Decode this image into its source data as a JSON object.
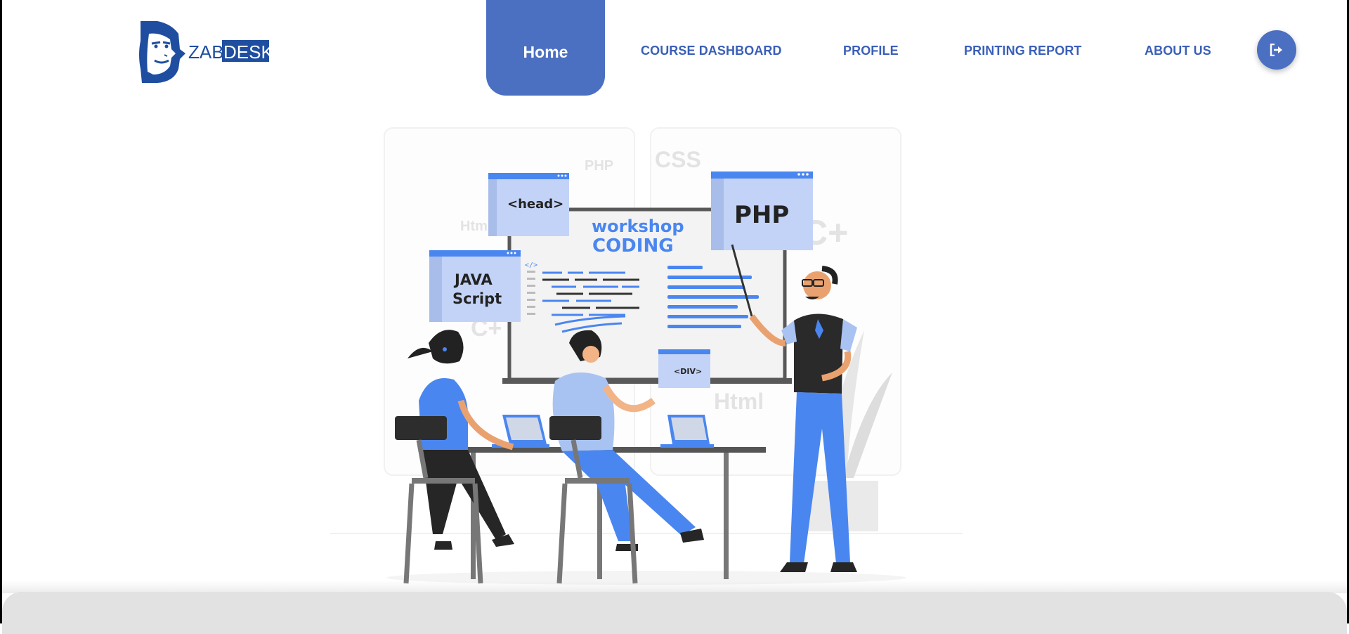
{
  "header": {
    "logo_text_left": "ZAB",
    "logo_text_right": "DESK"
  },
  "nav": {
    "home": "Home",
    "course_dashboard": "COURSE DASHBOARD",
    "profile": "PROFILE",
    "printing_report": "PRINTING REPORT",
    "about_us": "ABOUT US",
    "logout_icon": "sign-out-icon"
  },
  "hero": {
    "board_title_1": "workshop",
    "board_title_2": "CODING",
    "card_head": "<head>",
    "card_php": "PHP",
    "card_js_1": "JAVA",
    "card_js_2": "Script",
    "card_div": "<DIV>",
    "bg_php": "PHP",
    "bg_css": "CSS",
    "bg_html_1": "Htm",
    "bg_html_2": "Html",
    "bg_c1": "C+",
    "bg_c2": "C+",
    "code_tag": "</>"
  },
  "colors": {
    "accent": "#4b6fc1",
    "nav_text": "#3a5fb8",
    "illustration_blue": "#4a86f0",
    "light_blue": "#c3d3f7"
  }
}
